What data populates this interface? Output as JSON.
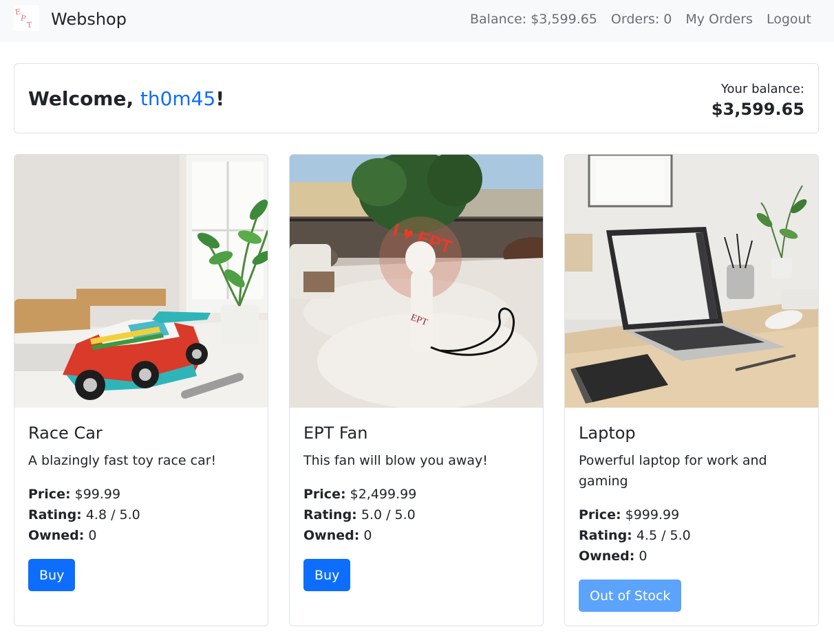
{
  "nav": {
    "logo_letters": [
      "E",
      "P",
      "T"
    ],
    "brand": "Webshop",
    "links": [
      {
        "label": "Balance: $3,599.65"
      },
      {
        "label": "Orders: 0"
      },
      {
        "label": "My Orders"
      },
      {
        "label": "Logout"
      }
    ]
  },
  "welcome": {
    "prefix": "Welcome, ",
    "username": "th0m45",
    "suffix": "!",
    "balance_label": "Your balance:",
    "balance_value": "$3,599.65"
  },
  "labels": {
    "price": "Price:",
    "rating": "Rating:",
    "owned": "Owned:"
  },
  "products": [
    {
      "title": "Race Car",
      "description": "A blazingly fast toy race car!",
      "price": "$99.99",
      "rating": "4.8 / 5.0",
      "owned": "0",
      "button": "Buy",
      "in_stock": true,
      "image_icon": "race-car-photo"
    },
    {
      "title": "EPT Fan",
      "description": "This fan will blow you away!",
      "price": "$2,499.99",
      "rating": "5.0 / 5.0",
      "owned": "0",
      "button": "Buy",
      "in_stock": true,
      "image_icon": "fan-photo",
      "image_text": "I ♥ EPT",
      "image_body_text": "EPT"
    },
    {
      "title": "Laptop",
      "description": "Powerful laptop for work and gaming",
      "price": "$999.99",
      "rating": "4.5 / 5.0",
      "owned": "0",
      "button": "Out of Stock",
      "in_stock": false,
      "image_icon": "laptop-photo"
    }
  ],
  "colors": {
    "primary": "#0d6efd",
    "primary_disabled": "#5ca3fc",
    "navbar_bg": "#f8f9fa",
    "nav_link": "#6a6e73"
  }
}
